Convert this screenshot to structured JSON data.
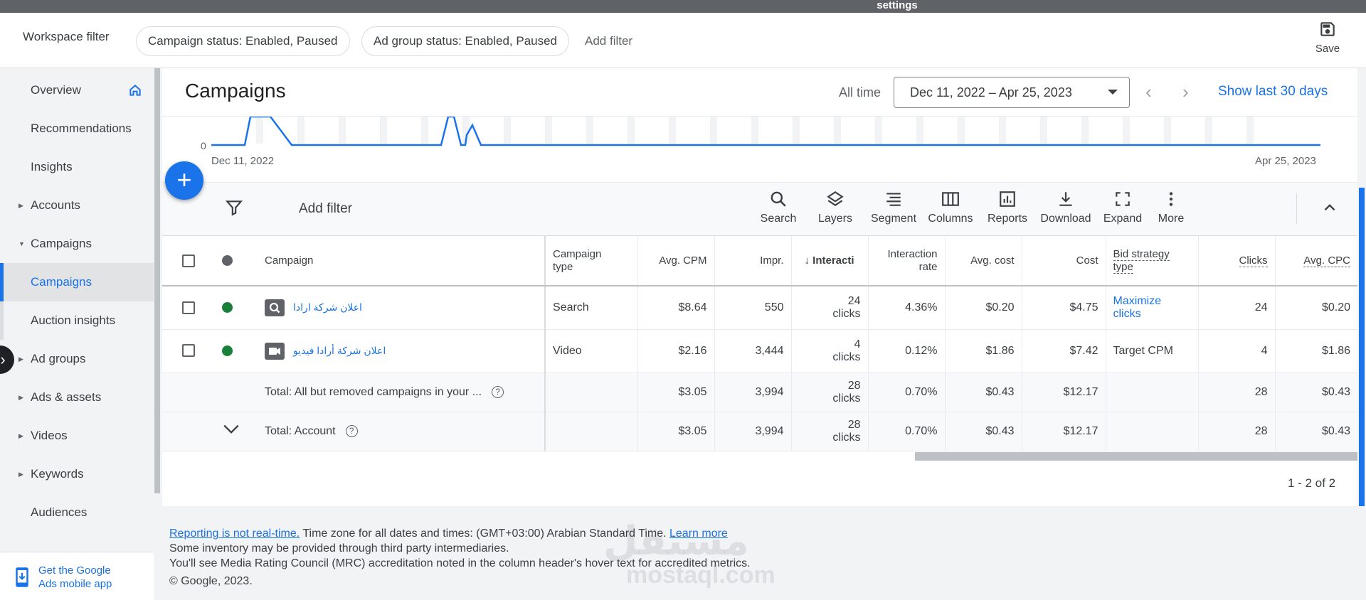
{
  "topbar": {
    "title": "settings"
  },
  "filters": {
    "label": "Workspace filter",
    "chips": [
      "Campaign status: Enabled, Paused",
      "Ad group status: Enabled, Paused"
    ],
    "add_filter": "Add filter",
    "save_label": "Save"
  },
  "sidebar": {
    "items": [
      {
        "label": "Overview"
      },
      {
        "label": "Recommendations"
      },
      {
        "label": "Insights"
      },
      {
        "label": "Accounts"
      },
      {
        "label": "Campaigns"
      },
      {
        "label": "Campaigns"
      },
      {
        "label": "Auction insights"
      },
      {
        "label": "Ad groups"
      },
      {
        "label": "Ads & assets"
      },
      {
        "label": "Videos"
      },
      {
        "label": "Keywords"
      },
      {
        "label": "Audiences"
      }
    ],
    "mobile_app": {
      "line1": "Get the Google",
      "line2": "Ads mobile app"
    }
  },
  "header": {
    "title": "Campaigns",
    "all_time": "All time",
    "date_range": "Dec 11, 2022 – Apr 25, 2023",
    "show_last": "Show last 30 days"
  },
  "chart_data": {
    "type": "line",
    "x_start_label": "Dec 11, 2022",
    "x_end_label": "Apr 25, 2023",
    "y_tick": "0",
    "color": "#1a73e8"
  },
  "toolbar": {
    "add_filter": "Add filter",
    "tools": [
      "Search",
      "Layers",
      "Segment",
      "Columns",
      "Reports",
      "Download",
      "Expand",
      "More"
    ]
  },
  "table": {
    "headers": {
      "campaign": "Campaign",
      "type_1": "Campaign",
      "type_2": "type",
      "avg_cpm": "Avg. CPM",
      "impr": "Impr.",
      "interactions": "Interacti",
      "rate_1": "Interaction",
      "rate_2": "rate",
      "avg_cost": "Avg. cost",
      "cost": "Cost",
      "bid_1": "Bid strategy",
      "bid_2": "type",
      "clicks": "Clicks",
      "avg_cpc": "Avg. CPC"
    },
    "rows": [
      {
        "name": "اعلان شركة ارادا",
        "type": "Search",
        "avg_cpm": "$8.64",
        "impr": "550",
        "int_n": "24",
        "int_u": "clicks",
        "rate": "4.36%",
        "avg_cost": "$0.20",
        "cost": "$4.75",
        "bid_1": "Maximize",
        "bid_2": "clicks",
        "clicks": "24",
        "avg_cpc": "$0.20",
        "status_color": "#188038"
      },
      {
        "name": "اعلان شركة أرادا فيديو",
        "type": "Video",
        "avg_cpm": "$2.16",
        "impr": "3,444",
        "int_n": "4",
        "int_u": "clicks",
        "rate": "0.12%",
        "avg_cost": "$1.86",
        "cost": "$7.42",
        "bid_1": "Target CPM",
        "bid_2": "",
        "clicks": "4",
        "avg_cpc": "$1.86",
        "status_color": "#188038"
      }
    ],
    "totals": [
      {
        "label": "Total: All but removed campaigns in your ...",
        "avg_cpm": "$3.05",
        "impr": "3,994",
        "int_n": "28",
        "int_u": "clicks",
        "rate": "0.70%",
        "avg_cost": "$0.43",
        "cost": "$12.17",
        "clicks": "28",
        "avg_cpc": "$0.43"
      },
      {
        "label": "Total: Account",
        "avg_cpm": "$3.05",
        "impr": "3,994",
        "int_n": "28",
        "int_u": "clicks",
        "rate": "0.70%",
        "avg_cost": "$0.43",
        "cost": "$12.17",
        "clicks": "28",
        "avg_cpc": "$0.43"
      }
    ],
    "pager": "1 - 2 of 2"
  },
  "footer": {
    "not_realtime": "Reporting is not real-time.",
    "timezone": " Time zone for all dates and times: (GMT+03:00) Arabian Standard Time. ",
    "learn_more": "Learn more",
    "line2": "Some inventory may be provided through third party intermediaries.",
    "line3": "You'll see Media Rating Council (MRC) accreditation noted in the column header's hover text for accredited metrics.",
    "copyright": "© Google, 2023."
  },
  "watermark": {
    "arabic": "مستقل",
    "latin": "mostaql.com"
  }
}
